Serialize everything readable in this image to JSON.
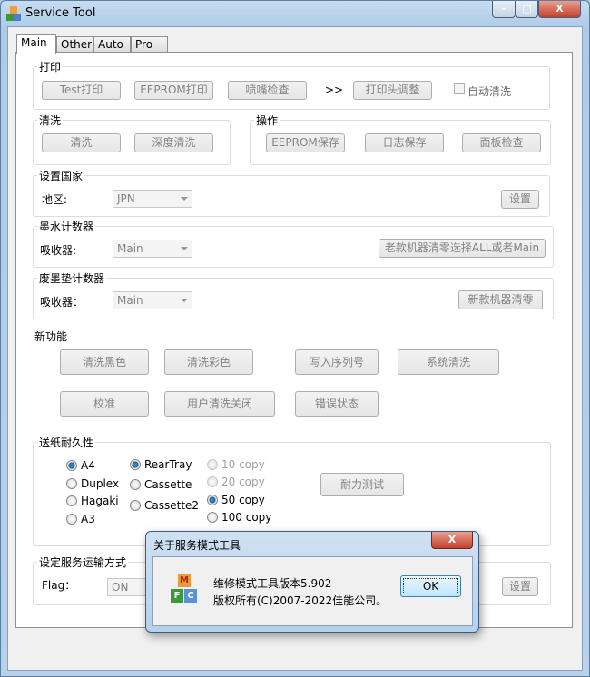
{
  "window": {
    "title": "Service Tool",
    "minimize": "–",
    "maximize": "□",
    "close": "X"
  },
  "tabs": [
    {
      "label": "Main"
    },
    {
      "label": "Other"
    },
    {
      "label": "Auto"
    },
    {
      "label": "Pro"
    }
  ],
  "print": {
    "label": "打印",
    "buttons": [
      "Test打印",
      "EEPROM打印",
      "喷嘴检查"
    ],
    "arrow": ">>",
    "head_align": "打印头调整",
    "auto_clean": {
      "label": "自动清洗",
      "checked": false
    }
  },
  "clean": {
    "label": "清洗",
    "buttons": [
      "清洗",
      "深度清洗"
    ]
  },
  "ops": {
    "label": "操作",
    "buttons": [
      "EEPROM保存",
      "日志保存",
      "面板检查"
    ]
  },
  "country": {
    "label": "设置国家",
    "field_label": "地区:",
    "value": "JPN",
    "button": "设置"
  },
  "ink_counter": {
    "label": "墨水计数器",
    "field_label": "吸收器:",
    "value": "Main",
    "button": "老款机器清零选择ALL或者Main"
  },
  "pad_counter": {
    "label": "废墨垫计数器",
    "field_label": "吸收器：",
    "value": "Main",
    "button": "新款机器清零"
  },
  "new_features": {
    "label": "新功能",
    "buttons": [
      "清洗黑色",
      "清洗彩色",
      "写入序列号",
      "系统清洗",
      "校准",
      "用户清洗关闭",
      "错误状态"
    ]
  },
  "feed": {
    "label": "送纸耐久性",
    "paper": [
      {
        "label": "A4",
        "checked": true
      },
      {
        "label": "Duplex",
        "checked": false
      },
      {
        "label": "Hagaki",
        "checked": false
      },
      {
        "label": "A3",
        "checked": false
      }
    ],
    "source": [
      {
        "label": "RearTray",
        "checked": true
      },
      {
        "label": "Cassette",
        "checked": false
      },
      {
        "label": "Cassette2",
        "checked": false
      }
    ],
    "copies": [
      {
        "label": "10 copy",
        "checked": false,
        "disabled": true
      },
      {
        "label": "20 copy",
        "checked": false,
        "disabled": true
      },
      {
        "label": "50 copy",
        "checked": true,
        "disabled": false
      },
      {
        "label": "100 copy",
        "checked": false,
        "disabled": false
      }
    ],
    "button": "耐力测试"
  },
  "shipping": {
    "label": "设定服务运输方式",
    "field_label": "Flag：",
    "value": "ON",
    "button": "设置"
  },
  "dialog": {
    "title": "关于服务模式工具",
    "line1": "维修模式工具版本5.902",
    "line2": "版权所有(C)2007-2022佳能公司。",
    "ok": "OK",
    "close": "X",
    "icon_text": [
      "M",
      "F",
      "C"
    ]
  }
}
